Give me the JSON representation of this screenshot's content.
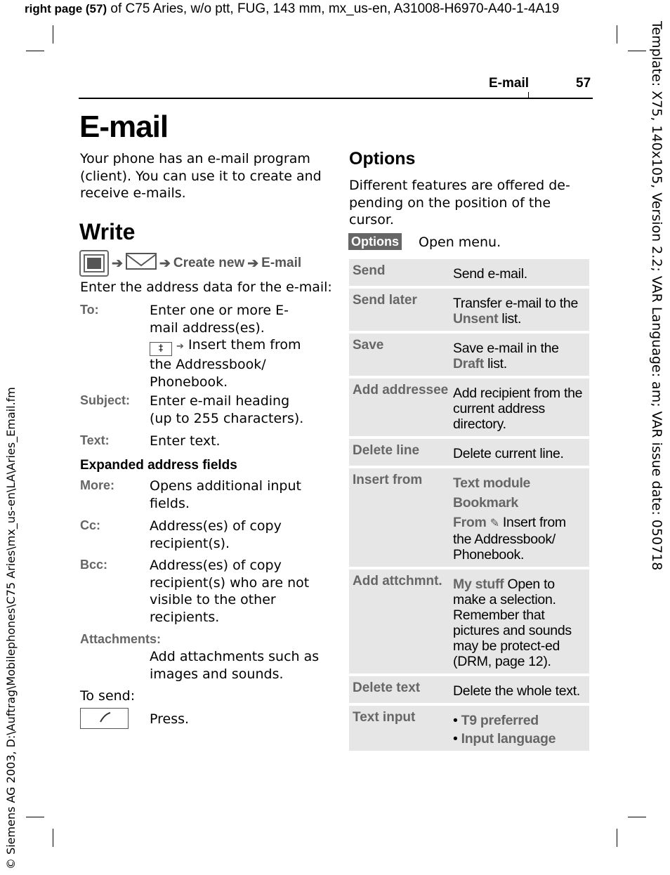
{
  "top_line": {
    "bold": "right page (57)",
    "rest": " of C75 Aries, w/o ptt, FUG, 143 mm, mx_us-en, A31008-H6970-A40-1-4A19"
  },
  "right_margin": "Template: X75, 140x105, Version 2.2; VAR Language: am; VAR issue date: 050718",
  "left_margin": "© Siemens AG 2003, D:\\Auftrag\\Mobilephones\\C75 Aries\\mx_us-en\\LA\\Aries_Email.fm",
  "header": {
    "section": "E-mail",
    "page": "57"
  },
  "title": "E-mail",
  "intro": "Your phone has an e-mail program (client). You can use it to create and receive e-mails.",
  "write": {
    "heading": "Write",
    "path": [
      "Create new",
      "E-mail"
    ],
    "icons": [
      "menu-key-icon",
      "envelope-icon"
    ],
    "intro": "Enter the address data for the e-mail:",
    "fields": [
      {
        "label": "To:",
        "text1": "Enter one or more E-mail address(es).",
        "key": "‡",
        "text2": "Insert them from the Addressbook/ Phonebook."
      },
      {
        "label": "Subject:",
        "text": "Enter e-mail heading (up to 255 characters)."
      },
      {
        "label": "Text:",
        "text": "Enter text."
      }
    ],
    "expanded_heading": "Expanded address fields",
    "expanded": [
      {
        "label": "More:",
        "text": "Opens additional input fields."
      },
      {
        "label": "Cc:",
        "text": "Address(es) of copy recipient(s)."
      },
      {
        "label": "Bcc:",
        "text": "Address(es) of copy recipient(s) who are not visible to the other recipients."
      },
      {
        "label": "Attachments:",
        "text": "Add attachments such as images and sounds."
      }
    ],
    "to_send": "To send:",
    "press": "Press."
  },
  "options": {
    "heading": "Options",
    "intro": "Different features are offered de-pending on the position of the cursor.",
    "softkey": "Options",
    "softkey_text": "Open menu.",
    "rows": [
      {
        "key": "Send",
        "v": "Send e-mail."
      },
      {
        "key": "Send later",
        "a": "Transfer e-mail to the ",
        "g": "Unsent",
        "b": " list."
      },
      {
        "key": "Save",
        "a": "Save e-mail in the ",
        "g": "Draft",
        "b": " list."
      },
      {
        "key": "Add addressee",
        "v": "Add recipient from the current address directory."
      },
      {
        "key": "Delete line",
        "v": "Delete current line."
      },
      {
        "key": "Insert from",
        "i1": "Text module",
        "i2": "Bookmark",
        "i3g": "From",
        "i3": " Insert from the Addressbook/ Phonebook."
      },
      {
        "key": "Add attchmnt.",
        "g": "My stuff",
        "b": " Open to make a selection. Remember that pictures and sounds may be protect-ed (DRM, page 12)."
      },
      {
        "key": "Delete text",
        "v": "Delete the whole text."
      },
      {
        "key": "Text input",
        "l1": "T9 preferred",
        "l2": "Input language"
      }
    ]
  }
}
